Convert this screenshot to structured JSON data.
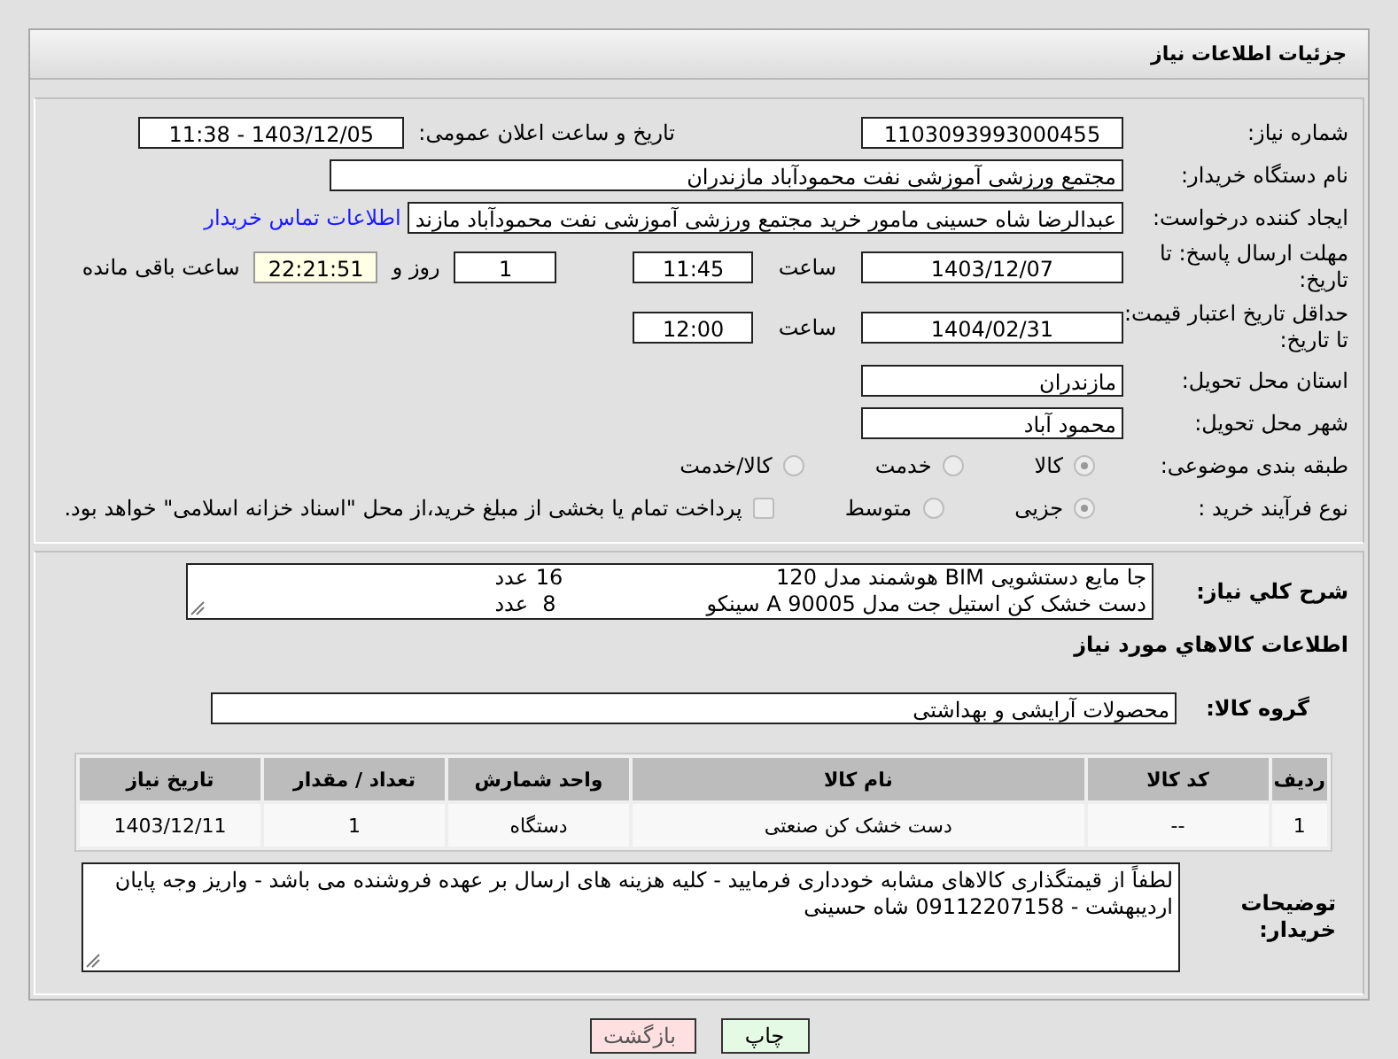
{
  "header": {
    "title": "جزئیات اطلاعات نیاز"
  },
  "need_number": {
    "label": "شماره نیاز:",
    "value": "1103093993000455"
  },
  "announce": {
    "label": "تاریخ و ساعت اعلان عمومی:",
    "value": "1403/12/05 - 11:38"
  },
  "buyer_org": {
    "label": "نام دستگاه خریدار:",
    "value": "مجتمع ورزشی آموزشی نفت محمودآباد مازندران"
  },
  "creator": {
    "label": "ایجاد کننده درخواست:",
    "value": "عبدالرضا شاه حسینی مامور خرید مجتمع ورزشی آموزشی نفت محمودآباد مازند",
    "link": "اطلاعات تماس خریدار"
  },
  "deadline": {
    "label": "مهلت ارسال پاسخ: تا تاریخ:",
    "date": "1403/12/07",
    "time_label": "ساعت",
    "time": "11:45",
    "days": "1",
    "days_label": "روز و",
    "remaining": "22:21:51",
    "remaining_label": "ساعت باقی مانده"
  },
  "validity": {
    "label": "حداقل تاریخ اعتبار قیمت: تا تاریخ:",
    "date": "1404/02/31",
    "time_label": "ساعت",
    "time": "12:00"
  },
  "province": {
    "label": "استان محل تحویل:",
    "value": "مازندران"
  },
  "city": {
    "label": "شهر محل تحویل:",
    "value": "محمود آباد"
  },
  "category": {
    "label": "طبقه بندی موضوعی:",
    "options": [
      {
        "label": "کالا",
        "selected": true
      },
      {
        "label": "خدمت",
        "selected": false
      },
      {
        "label": "کالا/خدمت",
        "selected": false
      }
    ]
  },
  "process": {
    "label": "نوع فرآیند خرید :",
    "options": [
      {
        "label": "جزیی",
        "selected": true
      },
      {
        "label": "متوسط",
        "selected": false
      }
    ],
    "treasury": {
      "checked": false,
      "text": "پرداخت تمام یا بخشی از مبلغ خرید،از محل \"اسناد خزانه اسلامی\" خواهد بود."
    }
  },
  "description": {
    "label": "شرح کلي نياز:",
    "lines": [
      {
        "text": "جا مایع دستشویی BIM هوشمند مدل 120",
        "quantity": "16",
        "unit": "عدد"
      },
      {
        "text": "دست خشک کن استیل جت مدل A 90005 سینکو",
        "quantity": "8",
        "unit": "عدد"
      }
    ]
  },
  "goods": {
    "heading": "اطلاعات كالاهاي مورد نياز",
    "group_label": "گروه کالا:",
    "group": "محصولات آرایشی و بهداشتی"
  },
  "table": {
    "columns": [
      "ردیف",
      "کد کالا",
      "نام کالا",
      "واحد شمارش",
      "تعداد / مقدار",
      "تاریخ نیاز"
    ],
    "rows": [
      [
        "1",
        "--",
        "دست خشک کن صنعتی",
        "دستگاه",
        "1",
        "1403/12/11"
      ]
    ]
  },
  "buyer_notes": {
    "label": "توضیحات خریدار:",
    "text": "لطفاً از قیمتگذاری کالاهای مشابه خودداری فرمایید - کلیه هزینه های ارسال بر عهده فروشنده می باشد - واریز وجه پایان اردیبهشت - 09112207158 شاه حسینی"
  },
  "buttons": [
    {
      "label": "چاپ",
      "kind": "print"
    },
    {
      "label": "بازگشت",
      "kind": "back"
    }
  ]
}
